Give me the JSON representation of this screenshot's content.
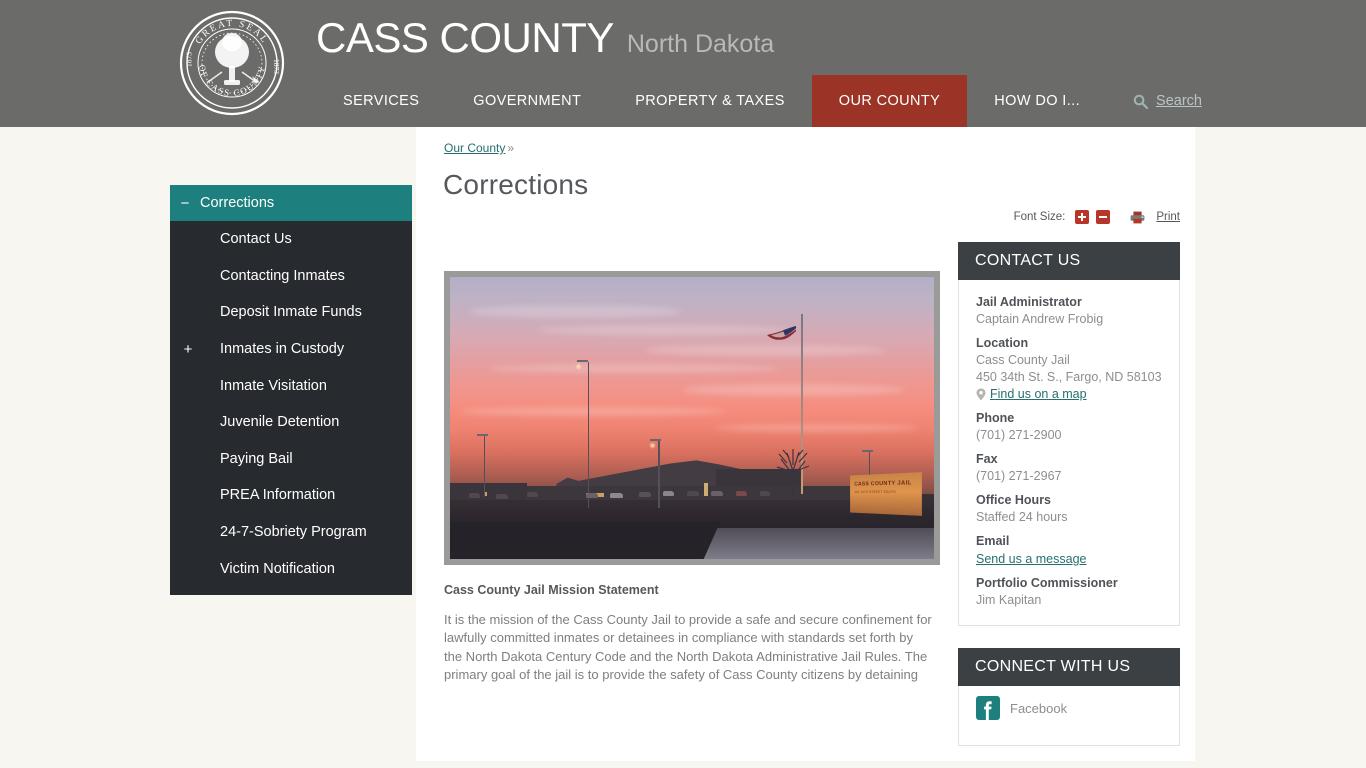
{
  "header": {
    "seal": {
      "top_text": "GREAT SEAL",
      "bottom_text": "OF CASS COUNTY",
      "year_left": "1873",
      "year_right": "1873"
    },
    "brand_main": "CASS COUNTY",
    "brand_sub": "North Dakota",
    "nav": [
      {
        "label": "SERVICES",
        "active": false
      },
      {
        "label": "GOVERNMENT",
        "active": false
      },
      {
        "label": "PROPERTY & TAXES",
        "active": false
      },
      {
        "label": "OUR COUNTY",
        "active": true
      },
      {
        "label": "HOW DO I...",
        "active": false
      }
    ],
    "search_label": "Search"
  },
  "colors": {
    "header_bg": "#6b6b69",
    "accent_red": "#9b3426",
    "page_bg": "#f7f6f1",
    "sidebar_bg": "#272a2e",
    "sidebar_head_teal": "#1d7f7e",
    "rail_head": "#3b4044",
    "link_teal": "#24706f",
    "fontsize_button_red": "#b8352a"
  },
  "sidebar": {
    "title": "Corrections",
    "title_twisty": "−",
    "items": [
      {
        "label": "Contact Us",
        "twisty": ""
      },
      {
        "label": "Contacting Inmates",
        "twisty": ""
      },
      {
        "label": "Deposit Inmate Funds",
        "twisty": ""
      },
      {
        "label": "Inmates in Custody",
        "twisty": "+"
      },
      {
        "label": "Inmate Visitation",
        "twisty": ""
      },
      {
        "label": "Juvenile Detention",
        "twisty": ""
      },
      {
        "label": "Paying Bail",
        "twisty": ""
      },
      {
        "label": "PREA Information",
        "twisty": ""
      },
      {
        "label": "24-7-Sobriety Program",
        "twisty": ""
      },
      {
        "label": "Victim Notification",
        "twisty": ""
      }
    ]
  },
  "main": {
    "breadcrumb_link": "Our County",
    "breadcrumb_sep": "»",
    "page_title": "Corrections",
    "toolbar": {
      "font_size_label": "Font Size:",
      "increase_label": "+",
      "decrease_label": "−",
      "print_label": "Print"
    },
    "photo": {
      "alt": "Cass County Jail at sunset",
      "sign_text": "CASS COUNTY JAIL",
      "sign_subtext": "450 34TH STREET SOUTH"
    },
    "body_heading": "Cass County Jail Mission Statement",
    "body_text": "It is the mission of the Cass County Jail to provide a safe and secure confinement for lawfully committed inmates or detainees in compliance with standards set forth by the North Dakota Century Code and the North Dakota Administrative Jail Rules. The primary goal of the jail is to provide the safety of Cass County citizens by detaining"
  },
  "rail": {
    "contact": {
      "title": "CONTACT US",
      "fields": [
        {
          "label": "Jail Administrator",
          "value": "Captain Andrew Frobig",
          "type": "text"
        },
        {
          "label": "Location",
          "value": "Cass County Jail",
          "type": "text"
        },
        {
          "label": "",
          "value": "450 34th St. S., Fargo, ND 58103",
          "type": "text"
        },
        {
          "label": "",
          "value": "Find us on a map",
          "type": "maplink"
        },
        {
          "label": "Phone",
          "value": "(701) 271-2900",
          "type": "text"
        },
        {
          "label": "Fax",
          "value": "(701) 271-2967",
          "type": "text"
        },
        {
          "label": "Office Hours",
          "value": "Staffed 24 hours",
          "type": "text"
        },
        {
          "label": "Email",
          "value": "Send us a message",
          "type": "link"
        },
        {
          "label": "Portfolio Commissioner",
          "value": "Jim Kapitan",
          "type": "text"
        }
      ]
    },
    "connect": {
      "title": "CONNECT WITH US",
      "social": [
        {
          "label": "Facebook",
          "icon": "facebook-icon"
        }
      ]
    }
  }
}
